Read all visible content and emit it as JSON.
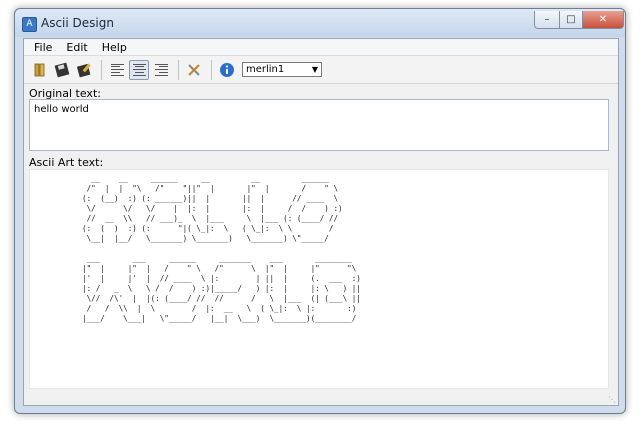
{
  "window": {
    "title": "Ascii Design"
  },
  "menu": [
    "File",
    "Edit",
    "Help"
  ],
  "toolbar": {
    "font_select": "merlin1"
  },
  "original": {
    "label": "Original text:",
    "value": "hello world"
  },
  "ascii": {
    "label": "Ascii Art text:",
    "art": "  __    __     ______     __         __         ______\n /\"  |  |  \"\\   /\"    \"||\"  |       |\"  |       /    \" \\\n(:  (__)  :) (: ______)||  |       ||  |      // ____  \\\n \\/      \\/   \\/    |  |:  |       |:  |     /  /    ) :)\n //  __  \\\\   // ___)_  \\  |___     \\  |___ (: (____/ //\n(:  (  )  :) (:      \"|( \\_|:  \\   ( \\_|:  \\ \\        /\n \\__|  |__/   \\_______) \\_______)   \\_______) \\\"_____/\n\n ___       ___     ______     _______    ___       ________\n|\"  |     |\"  |   /    \" \\   /\"      \\  |\"  |     |\"      \"\\\n|'  |     |'  |  // ____  \\ |:        | ||  |     (.  ___  :)\n|: /   _  \\   \\ /  /    ) :)|_____/   ) |:  |     |: \\   ) ||\n \\//  /\\'  |  |(: (____/ //  //      /   \\  |___  (| (___\\ ||\n /   /  \\\\  |  \\        /  |:  __   \\  ( \\_|:  \\ |:       :)\n|___/    \\___|   \\\"_____/   |__|  \\___)  \\_______)(________/"
  }
}
